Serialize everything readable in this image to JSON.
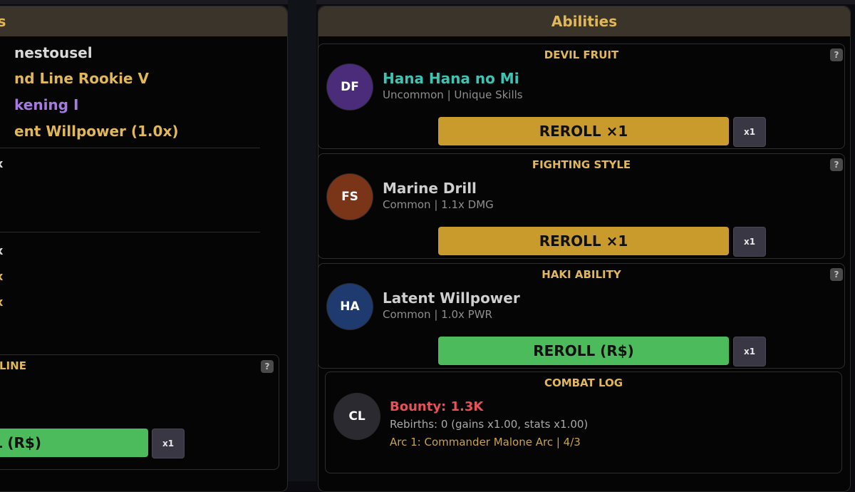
{
  "colors": {
    "gold": "#e0b85a",
    "button_gold": "#c99b2c",
    "button_green": "#4cbb5c",
    "header_bg": "#3a342b",
    "uncommon_teal": "#3fc3b3",
    "bounty_red": "#e8505a"
  },
  "left_panel": {
    "header": "ts",
    "lines": [
      {
        "text": "nestousel",
        "color": "#d9d9d9"
      },
      {
        "text": "nd Line Rookie V",
        "color": "#e0b85a"
      },
      {
        "text": "kening I",
        "color": "#a67ae0"
      },
      {
        "text": "ent Willpower (1.0x)",
        "color": "#e0b85a"
      }
    ],
    "mini_values": [
      "x",
      "x",
      "x",
      "x"
    ],
    "card": {
      "title": "LINE",
      "help": "?",
      "reroll_label": "L (R$)",
      "mult_label": "x1"
    }
  },
  "abilities": {
    "header": "Abilities",
    "cards": [
      {
        "title": "DEVIL FRUIT",
        "help": "?",
        "avatar": "DF",
        "avatar_color": "#4a2c7a",
        "name": "Hana Hana no Mi",
        "name_color": "#3fc3b3",
        "subtitle": "Uncommon | Unique Skills",
        "reroll_label": "REROLL ×1",
        "button_style": "gold",
        "mult_label": "x1"
      },
      {
        "title": "FIGHTING STYLE",
        "help": "?",
        "avatar": "FS",
        "avatar_color": "#7a3418",
        "name": "Marine Drill",
        "name_color": "#cfcfcf",
        "subtitle": "Common | 1.1x DMG",
        "reroll_label": "REROLL ×1",
        "button_style": "gold",
        "mult_label": "x1"
      },
      {
        "title": "HAKI ABILITY",
        "help": "?",
        "avatar": "HA",
        "avatar_color": "#1e3a6e",
        "name": "Latent Willpower",
        "name_color": "#cfcfcf",
        "subtitle": "Common | 1.0x PWR",
        "reroll_label": "REROLL (R$)",
        "button_style": "green",
        "mult_label": "x1"
      }
    ],
    "combat_log": {
      "title": "COMBAT LOG",
      "avatar": "CL",
      "bounty": "Bounty: 1.3K",
      "rebirths": "Rebirths: 0 (gains x1.00, stats x1.00)",
      "arc": "Arc 1: Commander Malone Arc | 4/3"
    }
  }
}
